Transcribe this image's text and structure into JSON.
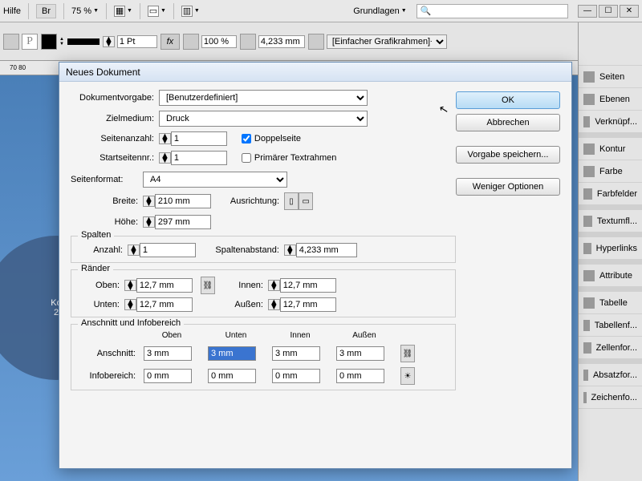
{
  "top": {
    "help": "Hilfe",
    "zoom": "75 %",
    "br": "Br",
    "workspace": "Grundlagen"
  },
  "tb2": {
    "pt": "1 Pt",
    "pct": "100 %",
    "meas": "4,233 mm",
    "frame": "[Einfacher Grafikrahmen]+"
  },
  "ruler": "70    80",
  "circ": {
    "a": "Ko",
    "b": "2"
  },
  "panels": [
    "Seiten",
    "Ebenen",
    "Verknüpf...",
    "Kontur",
    "Farbe",
    "Farbfelder",
    "Textumfl...",
    "Hyperlinks",
    "Attribute",
    "Tabelle",
    "Tabellenf...",
    "Zellenfor...",
    "Absatzfor...",
    "Zeichenfo..."
  ],
  "dlg": {
    "title": "Neues Dokument",
    "btn": {
      "ok": "OK",
      "cancel": "Abbrechen",
      "save": "Vorgabe speichern...",
      "less": "Weniger Optionen"
    },
    "lab": {
      "preset": "Dokumentvorgabe:",
      "intent": "Zielmedium:",
      "pages": "Seitenanzahl:",
      "start": "Startseitennr.:",
      "size": "Seitenformat:",
      "w": "Breite:",
      "h": "Höhe:",
      "orient": "Ausrichtung:",
      "cols": "Spalten",
      "count": "Anzahl:",
      "gutter": "Spaltenabstand:",
      "margins": "Ränder",
      "top": "Oben:",
      "bottom": "Unten:",
      "inside": "Innen:",
      "outside": "Außen:",
      "bleed": "Anschnitt und Infobereich",
      "bleedr": "Anschnitt:",
      "slugr": "Infobereich:",
      "facing": "Doppelseite",
      "mtf": "Primärer Textrahmen",
      "hdrtop": "Oben",
      "hdrbot": "Unten",
      "hdrin": "Innen",
      "hdrout": "Außen"
    },
    "val": {
      "preset": "[Benutzerdefiniert]",
      "intent": "Druck",
      "pages": "1",
      "start": "1",
      "size": "A4",
      "w": "210 mm",
      "h": "297 mm",
      "count": "1",
      "gutter": "4,233 mm",
      "m": "12,7 mm",
      "b": "3 mm",
      "s": "0 mm"
    }
  }
}
